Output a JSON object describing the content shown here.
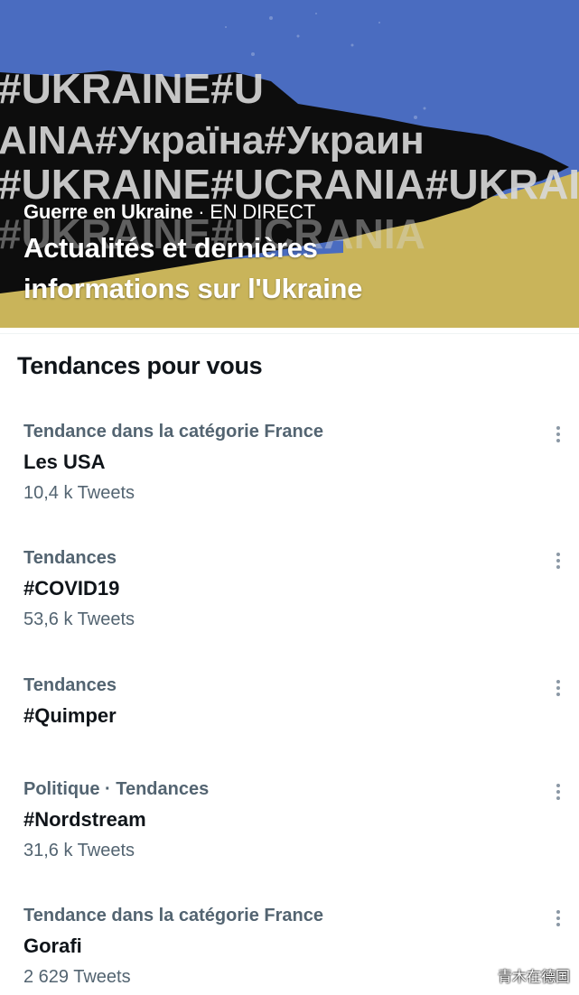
{
  "hero": {
    "kicker_topic": "Guerre en Ukraine",
    "kicker_live": " · EN DIRECT",
    "title": "Actualités et dernières informations sur l'Ukraine",
    "banner_lines": [
      "#UKRAINE#U",
      "AINA#Україна#Украин",
      "#UKRAINE#UCRANIA#UKRAIN",
      "#UKRAINE#UCRANIA"
    ],
    "colors": {
      "sky": "#4a6cc0",
      "field": "#c9b45a",
      "tear": "#0d0d0d"
    }
  },
  "section": {
    "title": "Tendances pour vous"
  },
  "trends": [
    {
      "category": "Tendance dans la catégorie France",
      "name": "Les USA",
      "count": "10,4 k Tweets"
    },
    {
      "category": "Tendances",
      "name": "#COVID19",
      "count": "53,6 k Tweets"
    },
    {
      "category": "Tendances",
      "name": "#Quimper",
      "count": ""
    },
    {
      "category": "Politique · Tendances",
      "name": "#Nordstream",
      "count": "31,6 k Tweets"
    },
    {
      "category": "Tendance dans la catégorie France",
      "name": "Gorafi",
      "count": "2 629 Tweets"
    }
  ],
  "icons": {
    "more": "more-options-icon"
  },
  "watermark": "青木在德国"
}
